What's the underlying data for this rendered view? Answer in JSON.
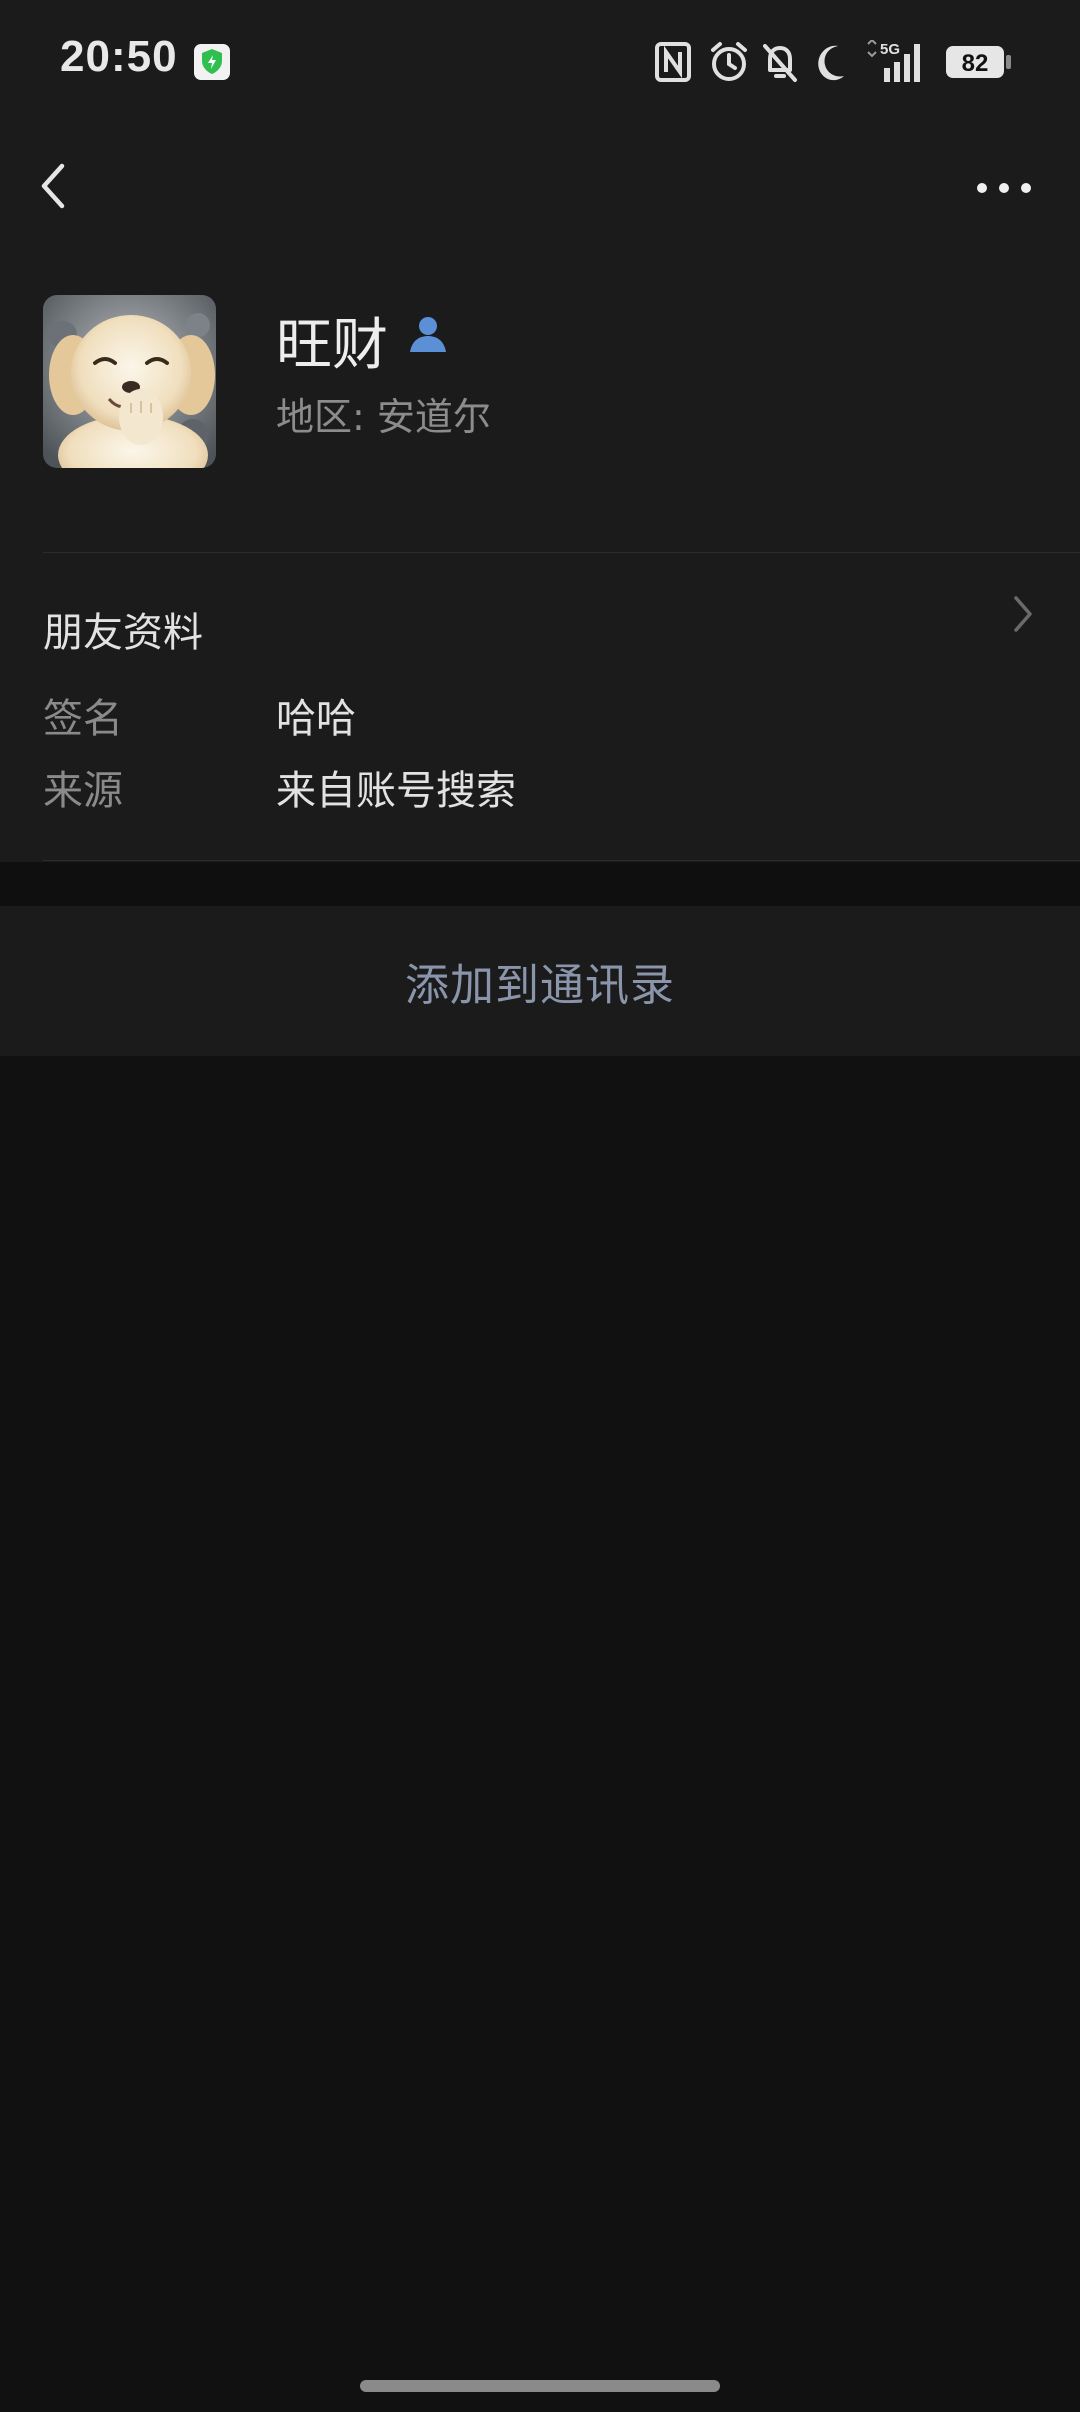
{
  "status_bar": {
    "time": "20:50",
    "network": "5G",
    "battery": "82",
    "icons": [
      "shield-check-icon",
      "nfc-icon",
      "alarm-icon",
      "bell-off-icon",
      "moon-icon",
      "signal-icon",
      "battery-icon"
    ]
  },
  "nav": {
    "back_icon": "chevron-left-icon",
    "more_icon": "more-horizontal-icon"
  },
  "profile": {
    "name": "旺财",
    "region": "地区:  安道尔",
    "badge_icon": "person-icon"
  },
  "friend_info": {
    "title": "朋友资料",
    "rows": [
      {
        "label": "签名",
        "value": "哈哈"
      },
      {
        "label": "来源",
        "value": "来自账号搜索"
      }
    ]
  },
  "actions": {
    "add_to_contacts": "添加到通讯录"
  },
  "colors": {
    "background": "#111111",
    "card": "#1b1b1b",
    "accent_text": "#8a95ab",
    "badge_blue": "#5b8fd6"
  }
}
